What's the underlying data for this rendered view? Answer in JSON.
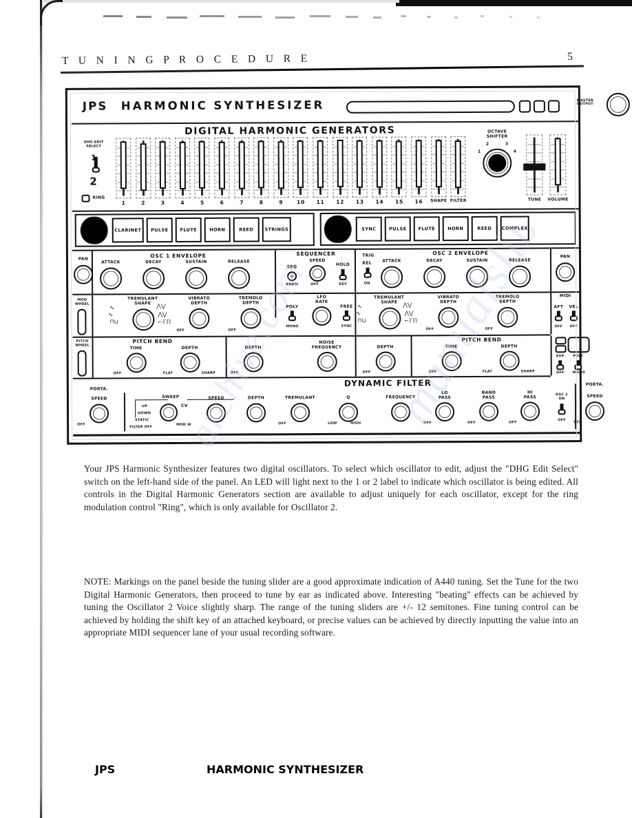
{
  "header": {
    "title": "T U N I N G    P R O C E D U R E",
    "page_number": "5"
  },
  "panel": {
    "brand": "JPS",
    "brand_rest": "HARMONIC SYNTHESIZER",
    "master_output_label": "MASTER\nOUTPUT",
    "dhg": {
      "title": "DIGITAL HARMONIC GENERATORS",
      "edit_select_label": "DHG EDIT\nSELECT",
      "edit_select_top": "1",
      "edit_select_bottom": "2",
      "ring_label": "RING",
      "harmonic_numbers": [
        "1",
        "2",
        "3",
        "4",
        "5",
        "6",
        "7",
        "8",
        "9",
        "10",
        "11",
        "12",
        "13",
        "14",
        "15",
        "16"
      ],
      "harmonic_values": [
        88,
        74,
        92,
        86,
        90,
        84,
        82,
        90,
        85,
        91,
        88,
        93,
        89,
        87,
        82,
        90
      ],
      "shape_label": "SHAPE",
      "shape_value": 90,
      "filter_label": "FILTER",
      "filter_value": 86,
      "octave_shifter_label": "OCTAVE\nSHIFTER",
      "octave_positions": [
        "1",
        "2",
        "3",
        "4"
      ],
      "tune_label": "TUNE",
      "tune_value": 50,
      "volume_label": "VOLUME",
      "volume_value": 92
    },
    "voices_osc1": [
      "CLARINET",
      "PULSE",
      "FLUTE",
      "HORN",
      "REED",
      "STRINGS"
    ],
    "voices_osc2": [
      "SYNC",
      "PULSE",
      "FLUTE",
      "HORN",
      "REED",
      "COMPLEX"
    ],
    "osc1_envelope": {
      "title": "OSC 1 ENVELOPE",
      "pan_label": "PAN",
      "knobs": [
        "ATTACK",
        "DECAY",
        "SUSTAIN",
        "RELEASE"
      ]
    },
    "osc2_envelope": {
      "title": "OSC 2 ENVELOPE",
      "pan_label": "PAN",
      "knobs": [
        "ATTACK",
        "DECAY",
        "SUSTAIN",
        "RELEASE"
      ],
      "trig_label": "TRIG",
      "trig_top": "REL",
      "trig_bottom": "ON"
    },
    "sequencer": {
      "title": "SEQUENCER",
      "speed_label": "SPEED",
      "seq_label": "SEQ",
      "rndm_label": "RNDM",
      "off_label": "OFF",
      "hold_label": "HOLD",
      "key_label": "KEY"
    },
    "mod_row": {
      "mod_wheel_label": "MOD\nWHEEL",
      "tremulant_shape_label": "TREMULANT\nSHAPE",
      "vibrato_depth_label": "VIBRATO\nDEPTH",
      "tremolo_depth_label": "TREMOLO\nDEPTH",
      "off_label": "OFF",
      "lfo_rate_label": "LFO\nRATE",
      "poly_label": "POLY",
      "mono_label": "MONO",
      "free_label": "FREE",
      "sync_label": "SYNC",
      "midi_label": "MIDI",
      "aft_label": "AFT",
      "vel_label": "VEL"
    },
    "bend_row": {
      "pitch_wheel_label": "PITCH\nWHEEL",
      "pitch_bend_label": "PITCH BEND",
      "time_label": "TIME",
      "depth_label": "DEPTH",
      "off_label": "OFF",
      "flat_label": "FLAT",
      "sharp_label": "SHARP",
      "noise_frequency_label": "NOISE\nFREQUENCY",
      "exp_label": "EXP",
      "poly_label": "POLY",
      "mono_label": "MONO"
    },
    "dynamic_filter": {
      "title": "DYNAMIC FILTER",
      "porta_label": "PORTA.",
      "speed_label": "SPEED",
      "off_label": "OFF",
      "sweep_label": "SWEEP",
      "sweep_options": [
        "UP",
        "DOWN",
        "STATIC",
        "FILTER OFF"
      ],
      "cv_label": "CV",
      "mod_w_label": "MOD W",
      "depth_label": "DEPTH",
      "tremulant_label": "TREMULANT",
      "q_label": "Q",
      "low_label": "LOW",
      "high_label": "HIGH",
      "frequency_label": "FREQUENCY",
      "lo_pass_label": "LO\nPASS",
      "band_pass_label": "BAND\nPASS",
      "hi_pass_label": "HI\nPASS",
      "osc2_on_label": "OSC 2\nON"
    }
  },
  "body": {
    "paragraph_1": "Your JPS Harmonic Synthesizer features two digital oscillators. To select which oscillator to edit, adjust the \"DHG Edit Select\" switch on the left-hand side of the panel. An LED will light next to the 1 or 2 label to indicate which oscillator is being edited. All controls in the Digital Harmonic Generators section are available to adjust uniquely for each oscillator, except for the ring modulation control \"Ring\", which is only available for Oscillator 2.",
    "paragraph_2": "NOTE: Markings on the panel beside the tuning slider are a good approximate indication of A440 tuning.  Set the Tune for the two Digital Harmonic Generators, then proceed to tune by ear as indicated above. Interesting \"beating\" effects can be achieved by tuning the Oscillator 2 Voice slightly sharp.  The range of the tuning sliders are +/- 12 semitones. Fine tuning control can be achieved by holding the shift key of an attached keyboard, or precise values can be achieved by directly inputting the value into an appropriate MIDI sequencer lane of your usual recording software."
  },
  "footer": {
    "brand": "JPS",
    "brand_rest": "HARMONIC SYNTHESIZER"
  },
  "watermark": {
    "text_1": "manualslib",
    "text_2": "archive.com"
  }
}
